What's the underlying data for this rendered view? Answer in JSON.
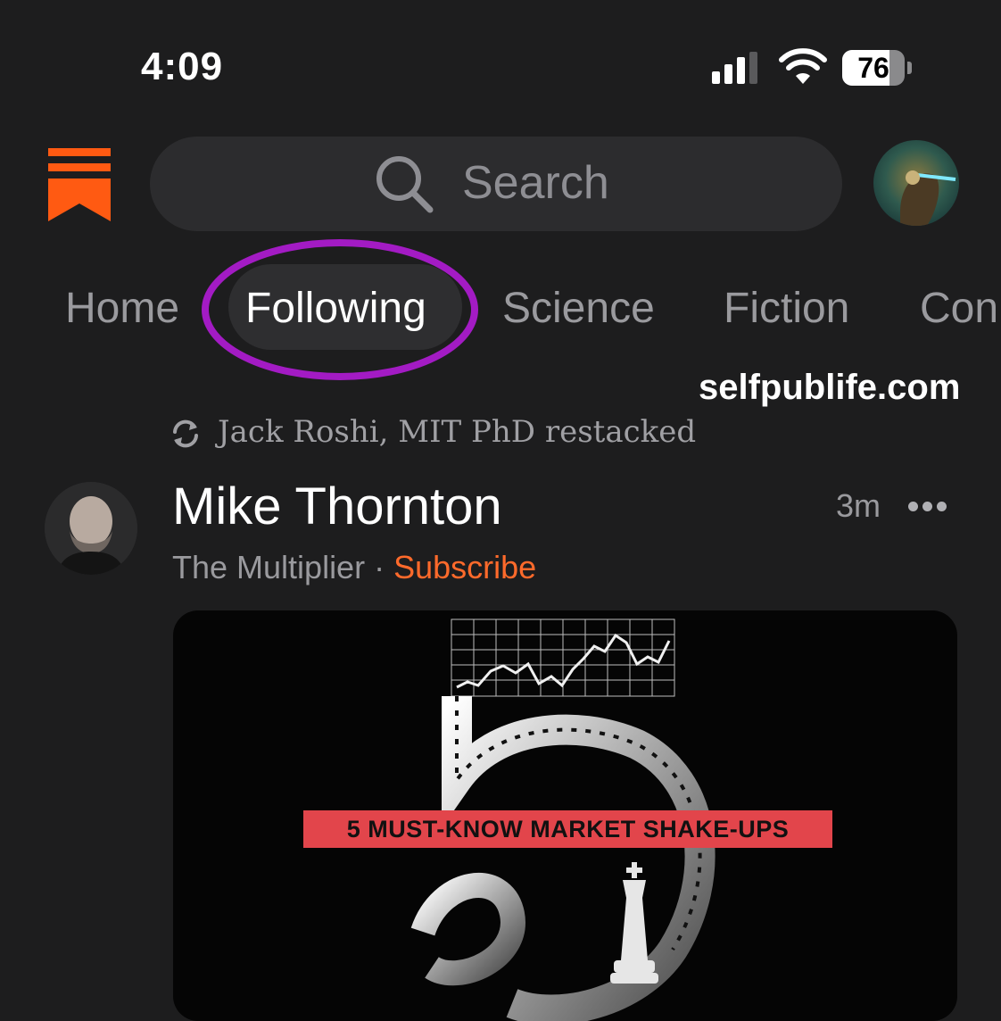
{
  "status_bar": {
    "time": "4:09",
    "battery_level": 76,
    "battery_label": "76",
    "signal_bars": 3,
    "signal_bars_total": 4
  },
  "header": {
    "search_placeholder": "Search",
    "logo_color": "#ff5a12"
  },
  "tabs": [
    {
      "label": "Home",
      "active": false
    },
    {
      "label": "Following",
      "active": true
    },
    {
      "label": "Science",
      "active": false
    },
    {
      "label": "Fiction",
      "active": false
    },
    {
      "label": "Con",
      "active": false
    }
  ],
  "annotation": {
    "highlight_color": "#a31bc4"
  },
  "watermark": "selfpublife.com",
  "post": {
    "restack_text": "Jack Roshi, MIT PhD restacked",
    "author": "Mike Thornton",
    "time_ago": "3m",
    "publication": "The Multiplier",
    "separator": " · ",
    "subscribe_label": "Subscribe",
    "image": {
      "headline": "5 MUST-KNOW MARKET SHAKE-UPS"
    }
  },
  "colors": {
    "accent": "#ff6a2b",
    "background": "#1d1d1e",
    "banner": "#e2454b"
  }
}
